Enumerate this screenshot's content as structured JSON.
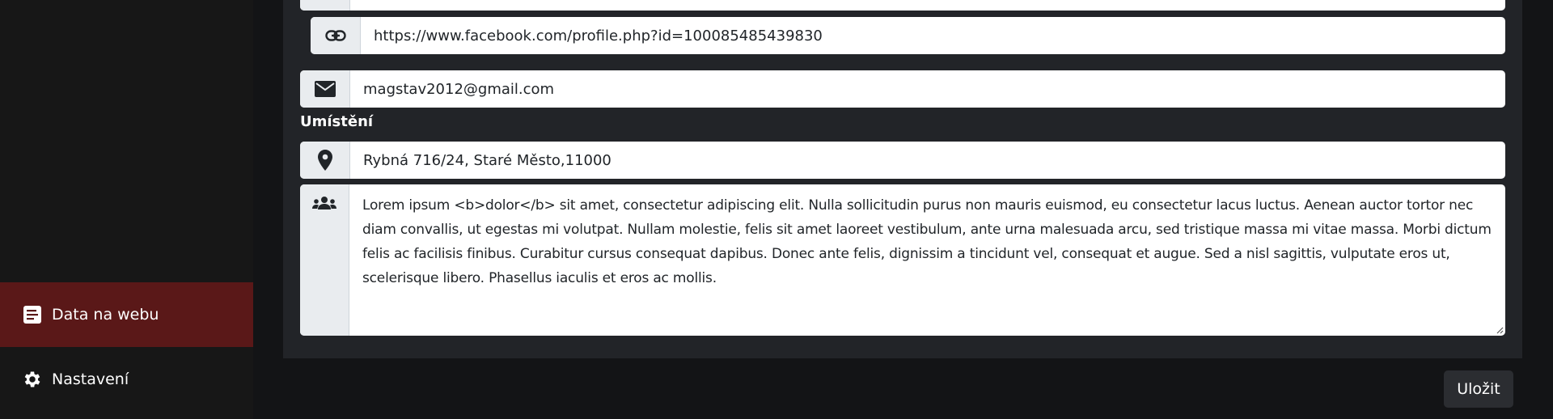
{
  "sidebar": {
    "items": [
      {
        "label": "Data na webu",
        "icon": "document-icon",
        "active": true
      },
      {
        "label": "Nastavení",
        "icon": "gear-icon",
        "active": false
      }
    ]
  },
  "form": {
    "facebook_url": "https://www.facebook.com/profile.php?id=100085485439830",
    "email": "magstav2012@gmail.com",
    "location_label": "Umístění",
    "address": "Rybná 716/24, Staré Město,11000",
    "description": "Lorem ipsum <b>dolor</b> sit amet, consectetur adipiscing elit. Nulla sollicitudin purus non mauris euismod, eu consectetur lacus luctus. Aenean auctor tortor nec diam convallis, ut egestas mi volutpat. Nullam molestie, felis sit amet laoreet vestibulum, ante urna malesuada arcu, sed tristique massa mi vitae massa. Morbi dictum felis ac facilisis finibus. Curabitur cursus consequat dapibus. Donec ante felis, dignissim a tincidunt vel, consequat et augue. Sed a nisl sagittis, vulputate eros ut, scelerisque libero. Phasellus iaculis et eros ac mollis."
  },
  "actions": {
    "save_label": "Uložit"
  },
  "colors": {
    "active_nav": "#5a1818",
    "panel": "#222428",
    "background": "#131416"
  }
}
